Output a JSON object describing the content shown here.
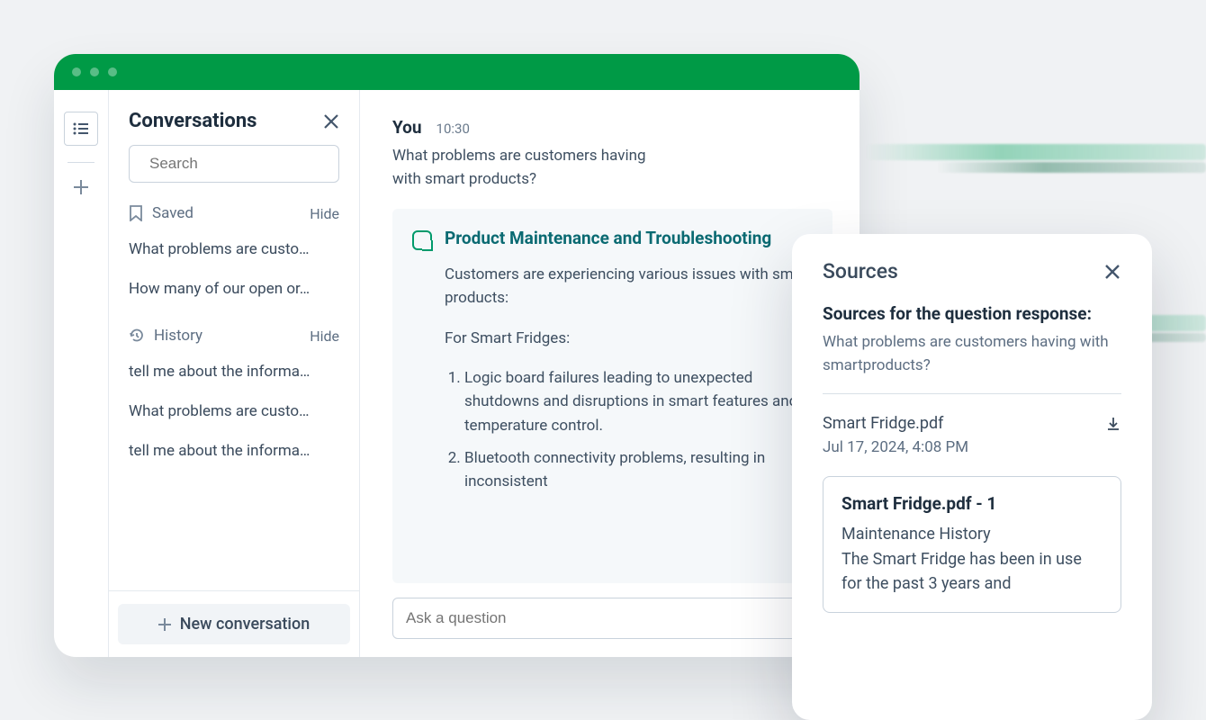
{
  "sidebar": {
    "title": "Conversations",
    "search_placeholder": "Search",
    "saved_label": "Saved",
    "history_label": "History",
    "hide_label": "Hide",
    "saved_items": [
      "What problems are custo…",
      "How many of our open or…"
    ],
    "history_items": [
      "tell me about the informa…",
      "What problems are custo…",
      "tell me about the informa…"
    ],
    "new_conversation_label": "New conversation"
  },
  "chat": {
    "user_label": "You",
    "user_time": "10:30",
    "user_text": "What problems are customers having with smart products?",
    "assistant_title": "Product Maintenance and Troubleshooting",
    "assistant_intro": "Customers are experiencing various issues with smart products:",
    "assistant_section_label": "For Smart Fridges:",
    "assistant_points": [
      "Logic board failures leading to unexpected shutdowns and disruptions in smart features and temperature control.",
      "Bluetooth connectivity problems, resulting in inconsistent"
    ],
    "ask_placeholder": "Ask a question"
  },
  "sources": {
    "panel_title": "Sources",
    "heading": "Sources for the question response:",
    "question": "What problems are customers having with smartproducts?",
    "file_name": "Smart Fridge.pdf",
    "file_date": "Jul 17, 2024, 4:08 PM",
    "card_title": "Smart Fridge.pdf - 1",
    "card_subtitle": "Maintenance History",
    "card_body": "The Smart Fridge has been in use for the past 3 years and"
  }
}
